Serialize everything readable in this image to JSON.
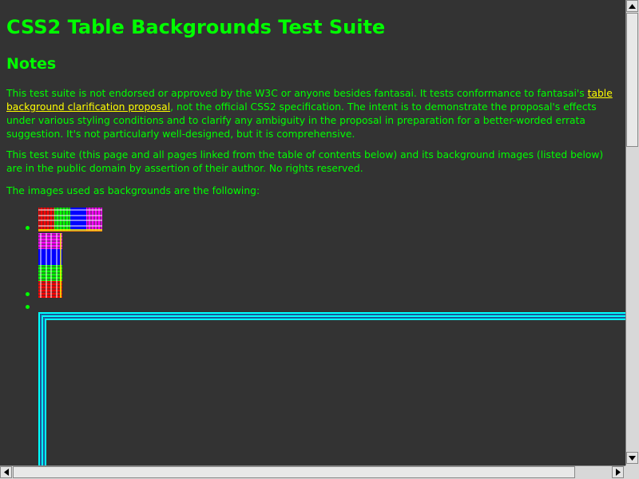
{
  "page": {
    "title": "CSS2 Table Backgrounds Test Suite",
    "notes_heading": "Notes",
    "p1_before": "This test suite is not endorsed or approved by the W3C or anyone besides fantasai. It tests conformance to fantasai's ",
    "p1_link": "table background clarification proposal",
    "p1_after": ", not the official CSS2 specification. The intent is to demonstrate the proposal's effects under various styling conditions and to clarify any ambiguity in the proposal in preparation for a better-worded errata suggestion. It's not particularly well-designed, but it is comprehensive.",
    "p2": "This test suite (this page and all pages linked from the table of contents below) and its background images (listed below) are in the public domain by assertion of their author. No rights reserved.",
    "p3": "The images used as backgrounds are the following:"
  },
  "images": [
    {
      "name": "horizontal-stripe-background-image",
      "colors": [
        "#ff0000",
        "#00ff00",
        "#0000ff",
        "#ff00ff"
      ]
    },
    {
      "name": "vertical-stripe-background-image",
      "colors": [
        "#ff00ff",
        "#0000ff",
        "#00ff00",
        "#ff0000"
      ]
    },
    {
      "name": "border-frame-background-image",
      "colors": [
        "#00ffff"
      ]
    }
  ],
  "colors": {
    "background": "#333333",
    "text": "#00ff00",
    "link": "#ffff00"
  }
}
